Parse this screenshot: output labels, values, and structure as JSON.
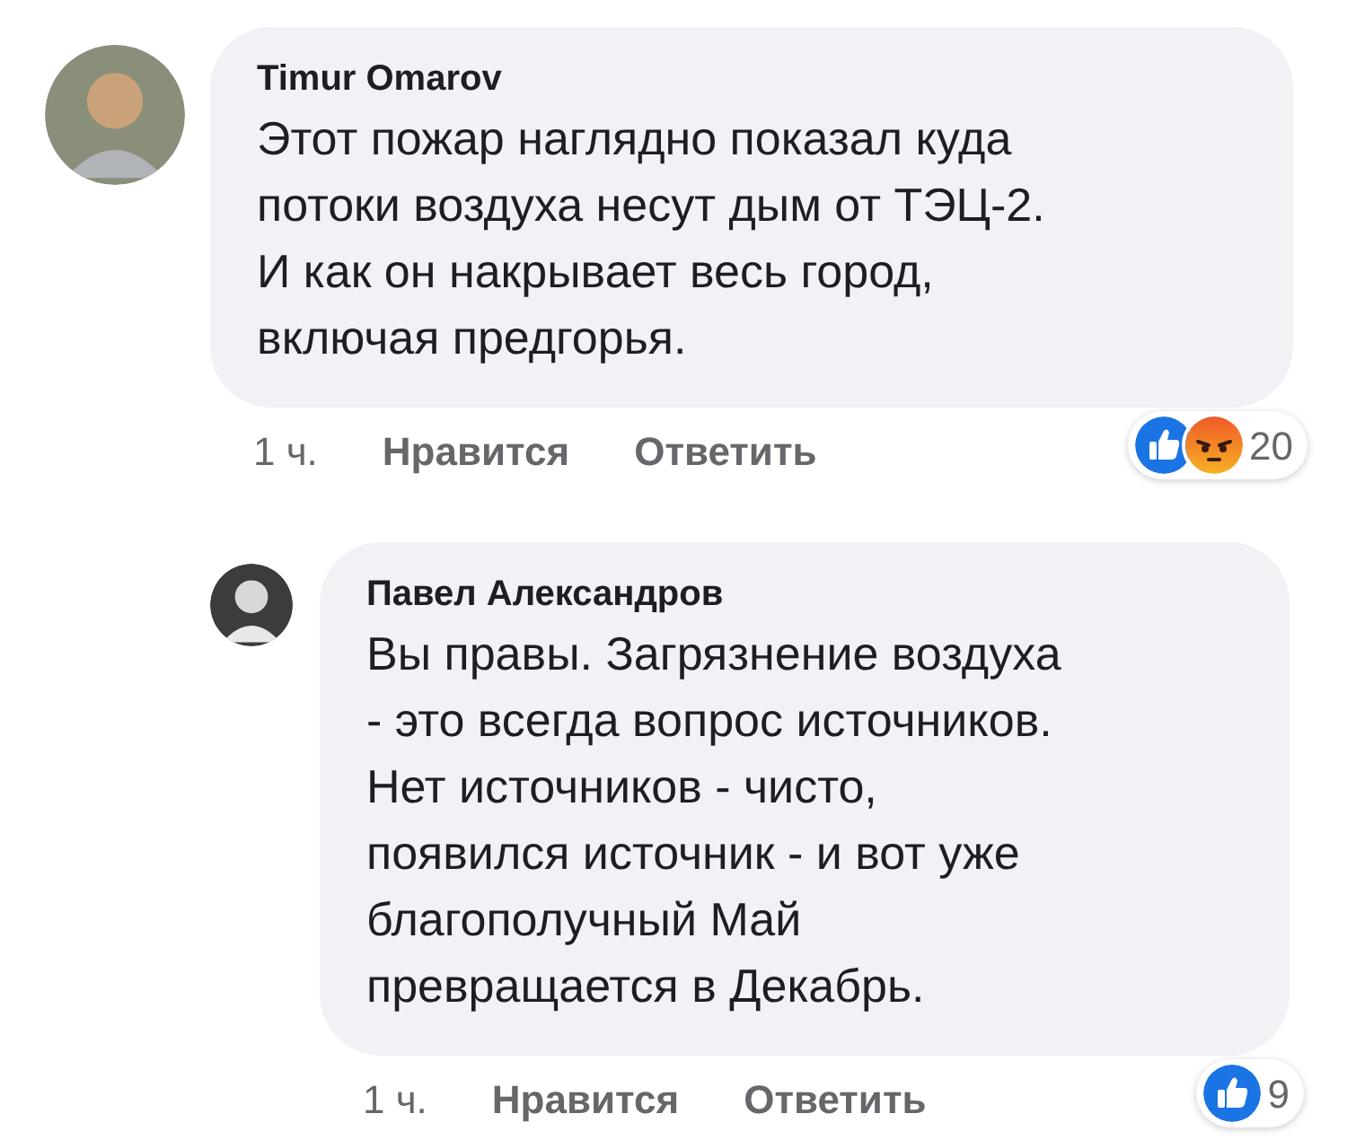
{
  "comments": [
    {
      "author": "Timur Omarov",
      "lines": [
        "Этот пожар наглядно показал куда",
        "потоки воздуха несут дым от ТЭЦ-2.",
        "И как он накрывает весь город,",
        "включая предгорья."
      ],
      "time": "1 ч.",
      "actions": [
        "Нравится",
        "Ответить"
      ],
      "reactions": [
        {
          "kind": "like"
        },
        {
          "kind": "angry"
        }
      ],
      "reaction_count": "20",
      "reply": false
    },
    {
      "author": "Павел Александров",
      "lines": [
        "Вы правы. Загрязнение воздуха",
        "- это всегда вопрос источников.",
        "Нет источников - чисто,",
        "появился источник - и вот уже",
        "благополучный Май",
        "превращается в Декабрь."
      ],
      "time": "1 ч.",
      "actions": [
        "Нравится",
        "Ответить"
      ],
      "reactions": [
        {
          "kind": "like"
        }
      ],
      "reaction_count": "9",
      "reply": true
    }
  ]
}
